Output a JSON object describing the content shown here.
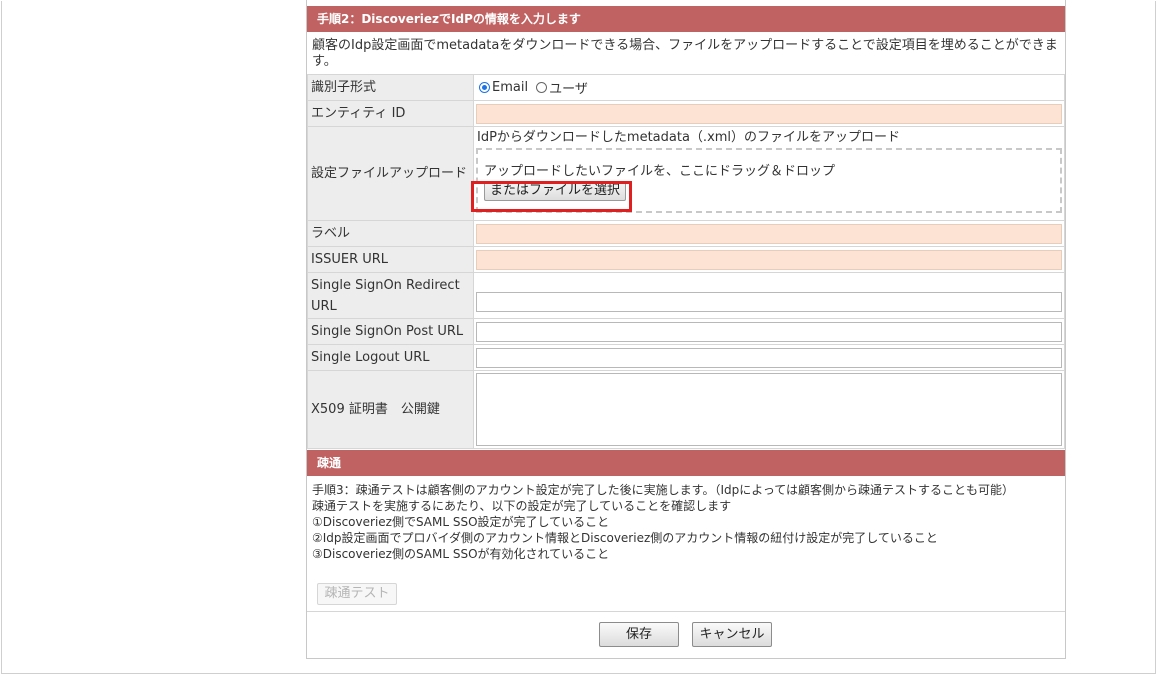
{
  "step2": {
    "header": "手順2：DiscoveriezでIdPの情報を入力します",
    "description": "顧客のIdp設定画面でmetadataをダウンロードできる場合、ファイルをアップロードすることで設定項目を埋めることができます。"
  },
  "form": {
    "identifier_format": {
      "label": "識別子形式",
      "options": [
        "Email",
        "ユーザ"
      ],
      "selected": "Email"
    },
    "entity_id": {
      "label": "エンティティ ID",
      "value": ""
    },
    "upload": {
      "label": "設定ファイルアップロード",
      "note": "IdPからダウンロードしたmetadata（.xml）のファイルをアップロード",
      "dropzone_text": "アップロードしたいファイルを、ここにドラッグ＆ドロップ",
      "choose_button": "またはファイルを選択"
    },
    "label_field": {
      "label": "ラベル",
      "value": ""
    },
    "issuer_url": {
      "label": "ISSUER URL",
      "value": ""
    },
    "sso_redirect_url": {
      "label": "Single SignOn Redirect URL",
      "value": ""
    },
    "sso_post_url": {
      "label": "Single SignOn Post URL",
      "value": ""
    },
    "logout_url": {
      "label": "Single Logout URL",
      "value": ""
    },
    "x509": {
      "label": "X509 証明書　公開鍵",
      "value": ""
    }
  },
  "sotsu": {
    "header": "疎通",
    "lines": [
      "手順3：疎通テストは顧客側のアカウント設定が完了した後に実施します。（Idpによっては顧客側から疎通テストすることも可能）",
      "疎通テストを実施するにあたり、以下の設定が完了していることを確認します",
      "①Discoveriez側でSAML SSO設定が完了していること",
      "②Idp設定画面でプロバイダ側のアカウント情報とDiscoveriez側のアカウント情報の紐付け設定が完了していること",
      "③Discoveriez側のSAML SSOが有効化されていること"
    ],
    "test_button": "疎通テスト"
  },
  "footer": {
    "save_button": "保存",
    "cancel_button": "キャンセル"
  },
  "colors": {
    "header_bg": "#c06262",
    "required_field_bg": "#fce3d4",
    "highlight": "#e02020"
  }
}
